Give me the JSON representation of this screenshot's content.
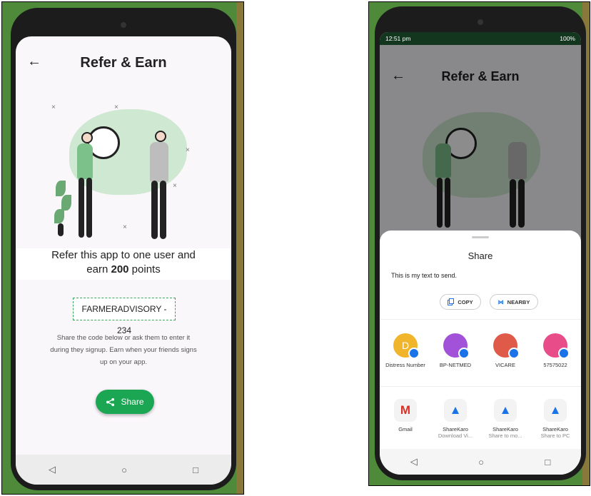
{
  "left_phone": {
    "header": {
      "back": "←",
      "title": "Refer & Earn"
    },
    "refer": {
      "line1": "Refer this app to one user and",
      "line2_prefix": "earn ",
      "points": "200",
      "line2_suffix": " points"
    },
    "code": "FARMERADVISORY - 234",
    "description": [
      "Share the code below or ask them to enter it",
      "during they signup. Earn when your friends signs",
      "up on your app."
    ],
    "share_button": {
      "icon": "share-icon",
      "label": "Share"
    },
    "nav": {
      "back": "◁",
      "home": "○",
      "recents": "□"
    }
  },
  "right_phone": {
    "status": {
      "time": "12:51 pm",
      "right": "100%"
    },
    "header": {
      "back": "←",
      "title": "Refer & Earn"
    },
    "sheet": {
      "title": "Share",
      "text": "This is my text to send.",
      "copy": "COPY",
      "nearby": "NEARBY",
      "contacts": [
        {
          "name": "Distress Number",
          "initial": "D",
          "color": "#f0b52a"
        },
        {
          "name": "BP-NETMED",
          "initial": "",
          "color": "#a252d9"
        },
        {
          "name": "VICARE",
          "initial": "",
          "color": "#e05a4a"
        },
        {
          "name": "57575022",
          "initial": "",
          "color": "#e84d8a"
        }
      ],
      "apps": [
        {
          "name": "Gmail",
          "sub": ""
        },
        {
          "name": "ShareKaro",
          "sub": "Download Vi..."
        },
        {
          "name": "ShareKaro",
          "sub": "Share to mo..."
        },
        {
          "name": "ShareKaro",
          "sub": "Share to PC"
        }
      ]
    },
    "nav": {
      "back": "◁",
      "home": "○",
      "recents": "□"
    }
  },
  "colors": {
    "accent": "#1aa653",
    "status_bar": "#12371e",
    "illustration_bg": "#cfe8d2"
  }
}
